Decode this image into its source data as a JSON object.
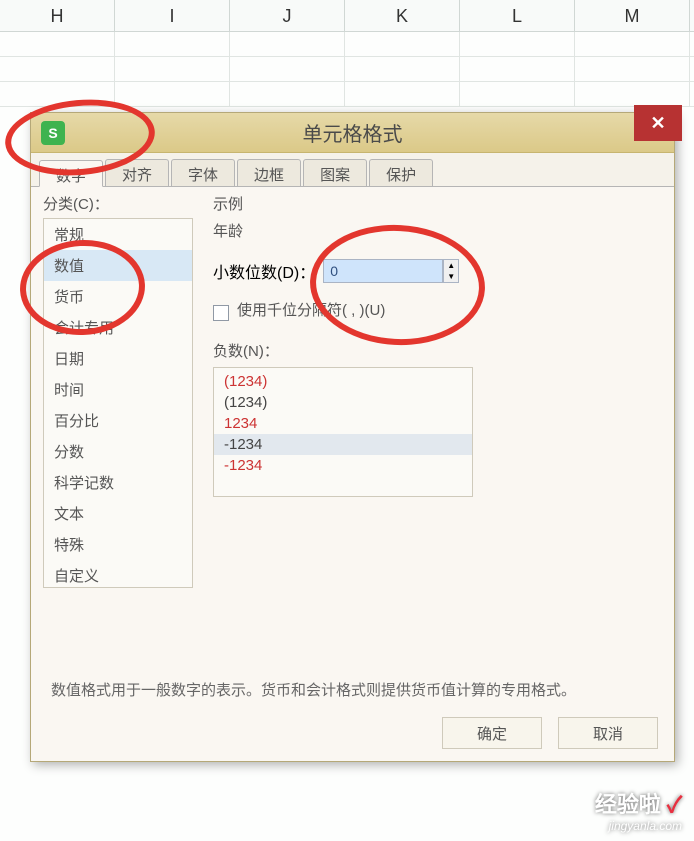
{
  "spreadsheet": {
    "columns": [
      "H",
      "I",
      "J",
      "K",
      "L",
      "M"
    ]
  },
  "dialog": {
    "title": "单元格格式",
    "app_icon_letter": "S",
    "close_label": "✕",
    "tabs": [
      "数字",
      "对齐",
      "字体",
      "边框",
      "图案",
      "保护"
    ],
    "category_label": "分类(C)：",
    "categories": [
      "常规",
      "数值",
      "货币",
      "会计专用",
      "日期",
      "时间",
      "百分比",
      "分数",
      "科学记数",
      "文本",
      "特殊",
      "自定义"
    ],
    "selected_category_index": 1,
    "example_label": "示例",
    "example_value": "年龄",
    "decimal_label": "小数位数(D)：",
    "decimal_value": "0",
    "thousands_label": "使用千位分隔符( , )(U)",
    "neg_label": "负数(N)：",
    "negatives": [
      {
        "text": "(1234)",
        "cls": "red"
      },
      {
        "text": "(1234)",
        "cls": "black"
      },
      {
        "text": "1234",
        "cls": "red"
      },
      {
        "text": "-1234",
        "cls": "black selected"
      },
      {
        "text": "-1234",
        "cls": "red"
      }
    ],
    "description": "数值格式用于一般数字的表示。货币和会计格式则提供货币值计算的专用格式。",
    "ok_label": "确定",
    "cancel_label": "取消"
  },
  "watermark": {
    "line1": "经验啦",
    "check": "✓",
    "line2": "jingyanla.com"
  }
}
